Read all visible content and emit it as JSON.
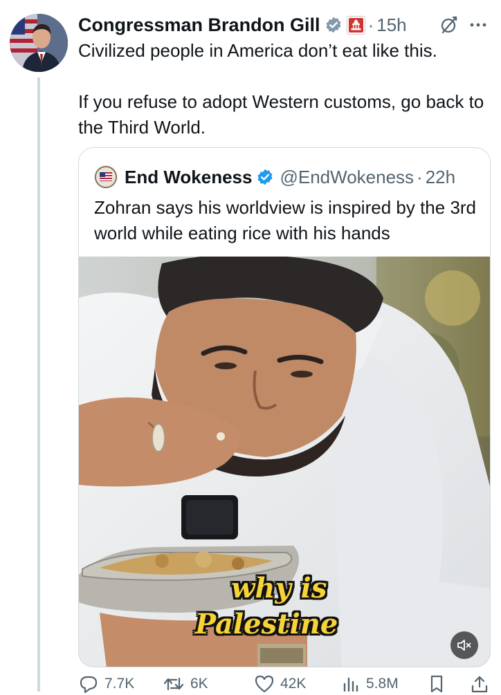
{
  "post": {
    "author": {
      "name": "Congressman Brandon Gill",
      "avatar_icon": "avatar-photo",
      "verified_icon": "verified-badge-icon",
      "affiliation_icon": "us-capitol-government-badge-icon"
    },
    "separator": "·",
    "time": "15h",
    "text_line_1": "Civilized people in America don’t eat like this.",
    "text_line_2": "If you refuse to adopt Western customs, go back to the Third World."
  },
  "quote": {
    "author_name": "End Wokeness",
    "handle": "@EndWokeness",
    "separator": "·",
    "time": "22h",
    "text": "Zohran says his worldview is inspired by the 3rd world while eating rice with his hands",
    "media": {
      "caption_line_1": "why is",
      "caption_line_2": "Palestine",
      "mute_icon": "speaker-muted-icon"
    }
  },
  "actions": {
    "replies": "7.7K",
    "reposts": "6K",
    "likes": "42K",
    "views": "5.8M"
  },
  "colors": {
    "text": "#0f1419",
    "secondary": "#536471",
    "verified_blue": "#1d9bf0",
    "verified_gray": "#829aab",
    "border": "#cfd9de",
    "caption_yellow": "#f7d33a"
  }
}
